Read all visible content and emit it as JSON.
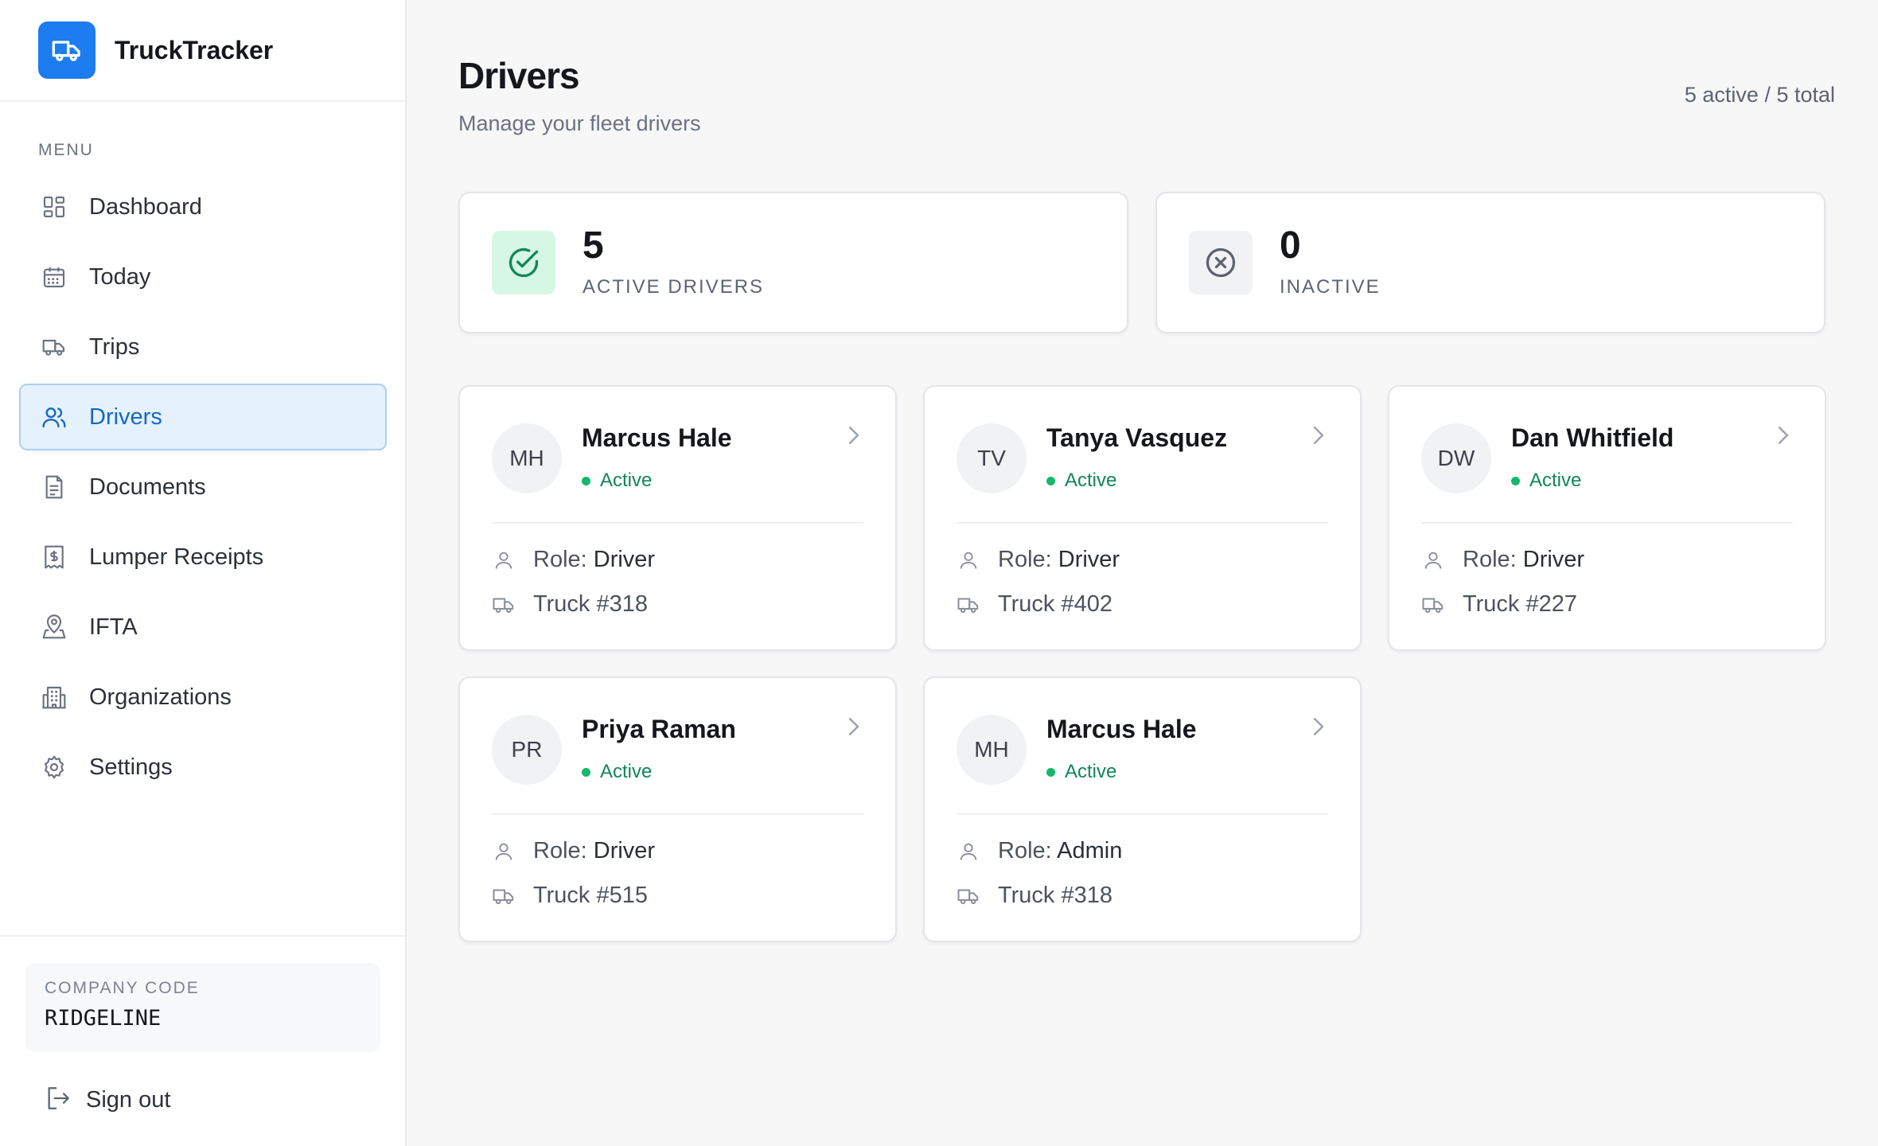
{
  "app": {
    "name": "TruckTracker",
    "logo_icon": "truck-icon",
    "accent": "#1c7cf0"
  },
  "sidebar": {
    "menu_label": "MENU",
    "items": [
      {
        "label": "Dashboard",
        "icon": "dashboard-icon",
        "active": false
      },
      {
        "label": "Today",
        "icon": "calendar-icon",
        "active": false
      },
      {
        "label": "Trips",
        "icon": "truck-icon",
        "active": false
      },
      {
        "label": "Drivers",
        "icon": "users-icon",
        "active": true
      },
      {
        "label": "Documents",
        "icon": "document-icon",
        "active": false
      },
      {
        "label": "Lumper Receipts",
        "icon": "receipt-icon",
        "active": false
      },
      {
        "label": "IFTA",
        "icon": "map-pin-icon",
        "active": false
      },
      {
        "label": "Organizations",
        "icon": "building-icon",
        "active": false
      },
      {
        "label": "Settings",
        "icon": "gear-icon",
        "active": false
      }
    ],
    "company": {
      "label": "COMPANY CODE",
      "code": "RIDGELINE"
    },
    "signout_label": "Sign out"
  },
  "page": {
    "title": "Drivers",
    "subtitle": "Manage your fleet drivers",
    "count_text": "5 active / 5 total"
  },
  "stats": [
    {
      "value": "5",
      "label": "ACTIVE DRIVERS",
      "icon": "check-circle-icon",
      "color": "#12855a"
    },
    {
      "value": "0",
      "label": "INACTIVE",
      "icon": "x-circle-icon",
      "color": "#5d6370"
    }
  ],
  "drivers": [
    {
      "initials": "MH",
      "name": "Marcus Hale",
      "status": "Active",
      "role_label": "Role:",
      "role": "Driver",
      "truck": "Truck #318"
    },
    {
      "initials": "TV",
      "name": "Tanya Vasquez",
      "status": "Active",
      "role_label": "Role:",
      "role": "Driver",
      "truck": "Truck #402"
    },
    {
      "initials": "DW",
      "name": "Dan Whitfield",
      "status": "Active",
      "role_label": "Role:",
      "role": "Driver",
      "truck": "Truck #227"
    },
    {
      "initials": "PR",
      "name": "Priya Raman",
      "status": "Active",
      "role_label": "Role:",
      "role": "Driver",
      "truck": "Truck #515"
    },
    {
      "initials": "MH",
      "name": "Marcus Hale",
      "status": "Active",
      "role_label": "Role:",
      "role": "Admin",
      "truck": "Truck #318"
    }
  ]
}
